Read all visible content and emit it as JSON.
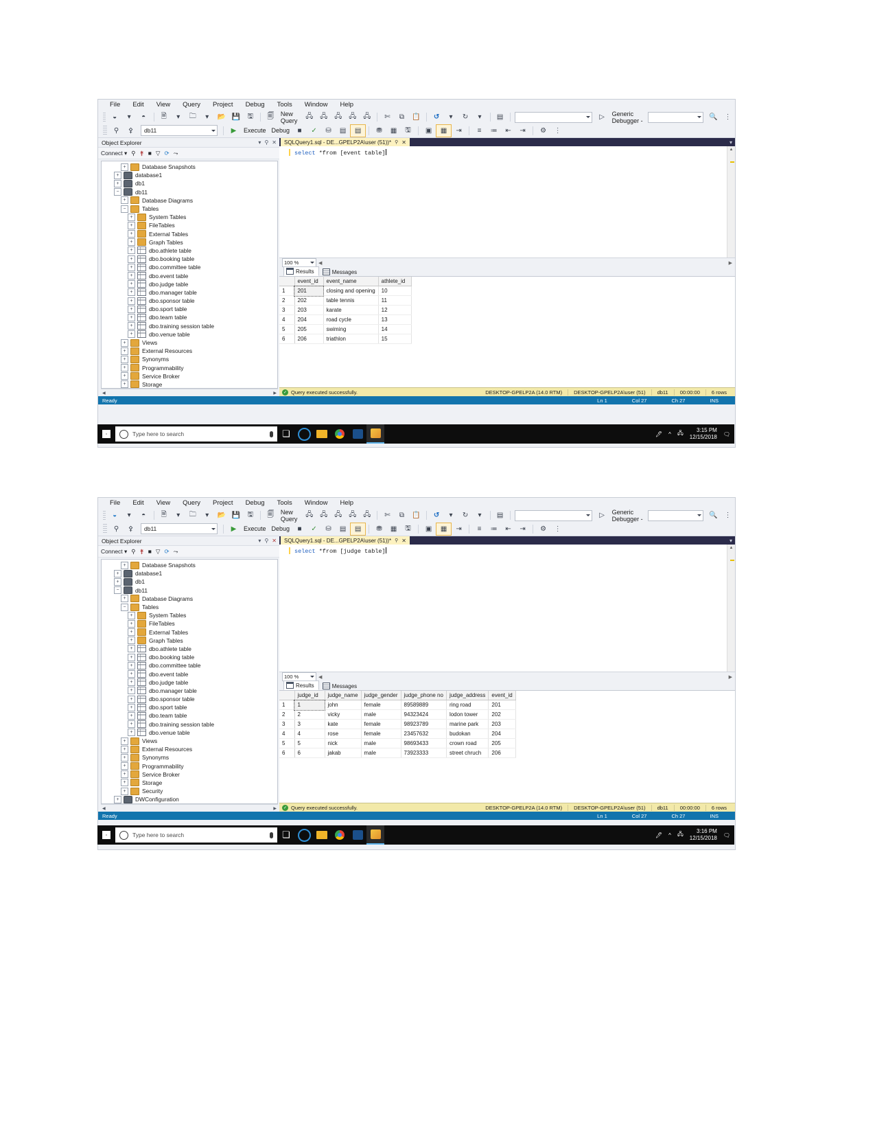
{
  "menu": [
    "File",
    "Edit",
    "View",
    "Query",
    "Project",
    "Debug",
    "Tools",
    "Window",
    "Help"
  ],
  "toolbar": {
    "new_query": "New Query",
    "debugger_placeholder": "Generic Debugger -",
    "database": "db11",
    "execute": "Execute",
    "debug": "Debug"
  },
  "object_explorer": {
    "title": "Object Explorer",
    "connect": "Connect ▾",
    "nodes": [
      {
        "label": "Database Snapshots",
        "icon": "folder-icon",
        "indent": 2,
        "state": "collapsed"
      },
      {
        "label": "database1",
        "icon": "database-icon",
        "indent": 1,
        "state": "collapsed"
      },
      {
        "label": "db1",
        "icon": "database-icon",
        "indent": 1,
        "state": "collapsed"
      },
      {
        "label": "db11",
        "icon": "database-icon",
        "indent": 1,
        "state": "expanded"
      },
      {
        "label": "Database Diagrams",
        "icon": "folder-icon",
        "indent": 2,
        "state": "collapsed"
      },
      {
        "label": "Tables",
        "icon": "folder-icon",
        "indent": 2,
        "state": "expanded"
      },
      {
        "label": "System Tables",
        "icon": "folder-icon",
        "indent": 3,
        "state": "collapsed"
      },
      {
        "label": "FileTables",
        "icon": "folder-icon",
        "indent": 3,
        "state": "collapsed"
      },
      {
        "label": "External Tables",
        "icon": "folder-icon",
        "indent": 3,
        "state": "collapsed"
      },
      {
        "label": "Graph Tables",
        "icon": "folder-icon",
        "indent": 3,
        "state": "collapsed"
      },
      {
        "label": "dbo.athlete table",
        "icon": "table-icon",
        "indent": 3,
        "state": "collapsed"
      },
      {
        "label": "dbo.booking table",
        "icon": "table-icon",
        "indent": 3,
        "state": "collapsed"
      },
      {
        "label": "dbo.committee table",
        "icon": "table-icon",
        "indent": 3,
        "state": "collapsed"
      },
      {
        "label": "dbo.event table",
        "icon": "table-icon",
        "indent": 3,
        "state": "collapsed"
      },
      {
        "label": "dbo.judge table",
        "icon": "table-icon",
        "indent": 3,
        "state": "collapsed"
      },
      {
        "label": "dbo.manager table",
        "icon": "table-icon",
        "indent": 3,
        "state": "collapsed"
      },
      {
        "label": "dbo.sponsor table",
        "icon": "table-icon",
        "indent": 3,
        "state": "collapsed"
      },
      {
        "label": "dbo.sport table",
        "icon": "table-icon",
        "indent": 3,
        "state": "collapsed"
      },
      {
        "label": "dbo.team table",
        "icon": "table-icon",
        "indent": 3,
        "state": "collapsed"
      },
      {
        "label": "dbo.training session table",
        "icon": "table-icon",
        "indent": 3,
        "state": "collapsed"
      },
      {
        "label": "dbo.venue table",
        "icon": "table-icon",
        "indent": 3,
        "state": "collapsed"
      },
      {
        "label": "Views",
        "icon": "folder-icon",
        "indent": 2,
        "state": "collapsed"
      },
      {
        "label": "External Resources",
        "icon": "folder-icon",
        "indent": 2,
        "state": "collapsed"
      },
      {
        "label": "Synonyms",
        "icon": "folder-icon",
        "indent": 2,
        "state": "collapsed"
      },
      {
        "label": "Programmability",
        "icon": "folder-icon",
        "indent": 2,
        "state": "collapsed"
      },
      {
        "label": "Service Broker",
        "icon": "folder-icon",
        "indent": 2,
        "state": "collapsed"
      },
      {
        "label": "Storage",
        "icon": "folder-icon",
        "indent": 2,
        "state": "collapsed"
      },
      {
        "label": "Security",
        "icon": "folder-icon",
        "indent": 2,
        "state": "collapsed"
      },
      {
        "label": "DWConfiguration",
        "icon": "database-icon",
        "indent": 1,
        "state": "collapsed"
      }
    ]
  },
  "shot1": {
    "tab_title": "SQLQuery1.sql - DE...GPELP2A\\user (51))*",
    "query_keyword": "select",
    "query_rest": " *from [event table]",
    "zoom": "100 %",
    "results_tab": "Results",
    "messages_tab": "Messages",
    "grid": {
      "columns": [
        "",
        "event_id",
        "event_name",
        "athlete_id"
      ],
      "rows": [
        [
          "1",
          "201",
          "closing and opening",
          "10"
        ],
        [
          "2",
          "202",
          "table tennis",
          "11"
        ],
        [
          "3",
          "203",
          "karate",
          "12"
        ],
        [
          "4",
          "204",
          "road cycle",
          "13"
        ],
        [
          "5",
          "205",
          "swiming",
          "14"
        ],
        [
          "6",
          "206",
          "triathlon",
          "15"
        ]
      ]
    },
    "status": {
      "message": "Query executed successfully.",
      "server": "DESKTOP-GPELP2A (14.0 RTM)",
      "user": "DESKTOP-GPELP2A\\user (51)",
      "database": "db11",
      "elapsed": "00:00:00",
      "rows": "6 rows"
    },
    "bottom": {
      "ready": "Ready",
      "ln": "Ln 1",
      "col": "Col 27",
      "ch": "Ch 27",
      "ins": "INS"
    },
    "clock": {
      "time": "3:15 PM",
      "date": "12/15/2018"
    }
  },
  "shot2": {
    "tab_title": "SQLQuery1.sql - DE...GPELP2A\\user (51))*",
    "query_keyword": "select",
    "query_rest": " *from [judge table]",
    "zoom": "100 %",
    "results_tab": "Results",
    "messages_tab": "Messages",
    "grid": {
      "columns": [
        "",
        "judge_id",
        "judge_name",
        "judge_gender",
        "judge_phone no",
        "judge_address",
        "event_id"
      ],
      "rows": [
        [
          "1",
          "1",
          "john",
          "female",
          "89589889",
          "ring road",
          "201"
        ],
        [
          "2",
          "2",
          "vicky",
          "male",
          "94323424",
          "lodon tower",
          "202"
        ],
        [
          "3",
          "3",
          "kate",
          "female",
          "98923789",
          "marine park",
          "203"
        ],
        [
          "4",
          "4",
          "rose",
          "female",
          "23457632",
          "budokan",
          "204"
        ],
        [
          "5",
          "5",
          "nick",
          "male",
          "98693433",
          "crown road",
          "205"
        ],
        [
          "6",
          "6",
          "jakab",
          "male",
          "73923333",
          "street chruch",
          "206"
        ]
      ]
    },
    "status": {
      "message": "Query executed successfully.",
      "server": "DESKTOP-GPELP2A (14.0 RTM)",
      "user": "DESKTOP-GPELP2A\\user (51)",
      "database": "db11",
      "elapsed": "00:00:00",
      "rows": "6 rows"
    },
    "bottom": {
      "ready": "Ready",
      "ln": "Ln 1",
      "col": "Col 27",
      "ch": "Ch 27",
      "ins": "INS"
    },
    "clock": {
      "time": "3:16 PM",
      "date": "12/15/2018"
    }
  },
  "taskbar": {
    "search_placeholder": "Type here to search"
  },
  "colors": {
    "accent": "#1274ad",
    "status_yellow": "#f2e9a9",
    "tab_yellow": "#fdf2c0",
    "editor_dark": "#1e1e3f"
  }
}
